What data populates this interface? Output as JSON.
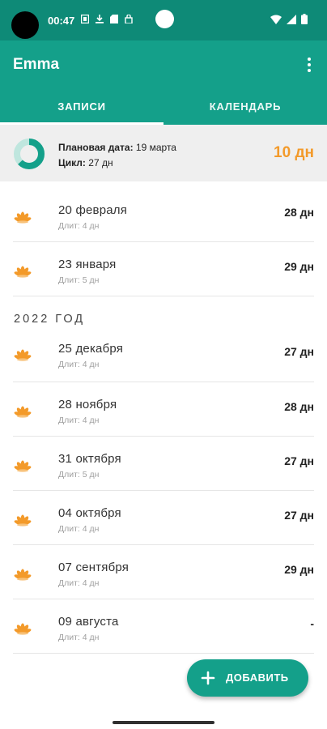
{
  "status_bar": {
    "time": "00:47",
    "icons": [
      "sim-icon",
      "download-icon",
      "sd-card-icon",
      "vpn-icon"
    ],
    "right_icons": [
      "wifi-icon",
      "signal-icon",
      "battery-icon"
    ]
  },
  "app": {
    "title": "Emma",
    "menu_icon": "more-vert-icon"
  },
  "tabs": [
    {
      "label": "ЗАПИСИ",
      "active": true
    },
    {
      "label": "КАЛЕНДАРЬ",
      "active": false
    }
  ],
  "summary": {
    "planned_label": "Плановая дата:",
    "planned_value": "19 марта",
    "cycle_label": "Цикл:",
    "cycle_value": "27 дн",
    "days_left": "10 дн",
    "progress_fraction": 0.63,
    "accent_color": "#f39a2a"
  },
  "records": [
    {
      "date": "20 февраля",
      "duration": "Длит: 4 дн",
      "length": "28 дн"
    },
    {
      "date": "23 января",
      "duration": "Длит: 5 дн",
      "length": "29 дн"
    }
  ],
  "year_header": "2022 ГОД",
  "records_2022": [
    {
      "date": "25 декабря",
      "duration": "Длит: 4 дн",
      "length": "27 дн"
    },
    {
      "date": "28 ноября",
      "duration": "Длит: 4 дн",
      "length": "28 дн"
    },
    {
      "date": "31 октября",
      "duration": "Длит: 5 дн",
      "length": "27 дн"
    },
    {
      "date": "04 октября",
      "duration": "Длит: 4 дн",
      "length": "27 дн"
    },
    {
      "date": "07 сентября",
      "duration": "Длит: 4 дн",
      "length": "29 дн"
    },
    {
      "date": "09 августа",
      "duration": "Длит: 4 дн",
      "length": "-"
    }
  ],
  "fab": {
    "label": "ДОБАВИТЬ",
    "icon": "plus-icon"
  },
  "colors": {
    "primary": "#14a08a",
    "status_bar": "#0e8a77",
    "accent": "#f39a2a"
  }
}
